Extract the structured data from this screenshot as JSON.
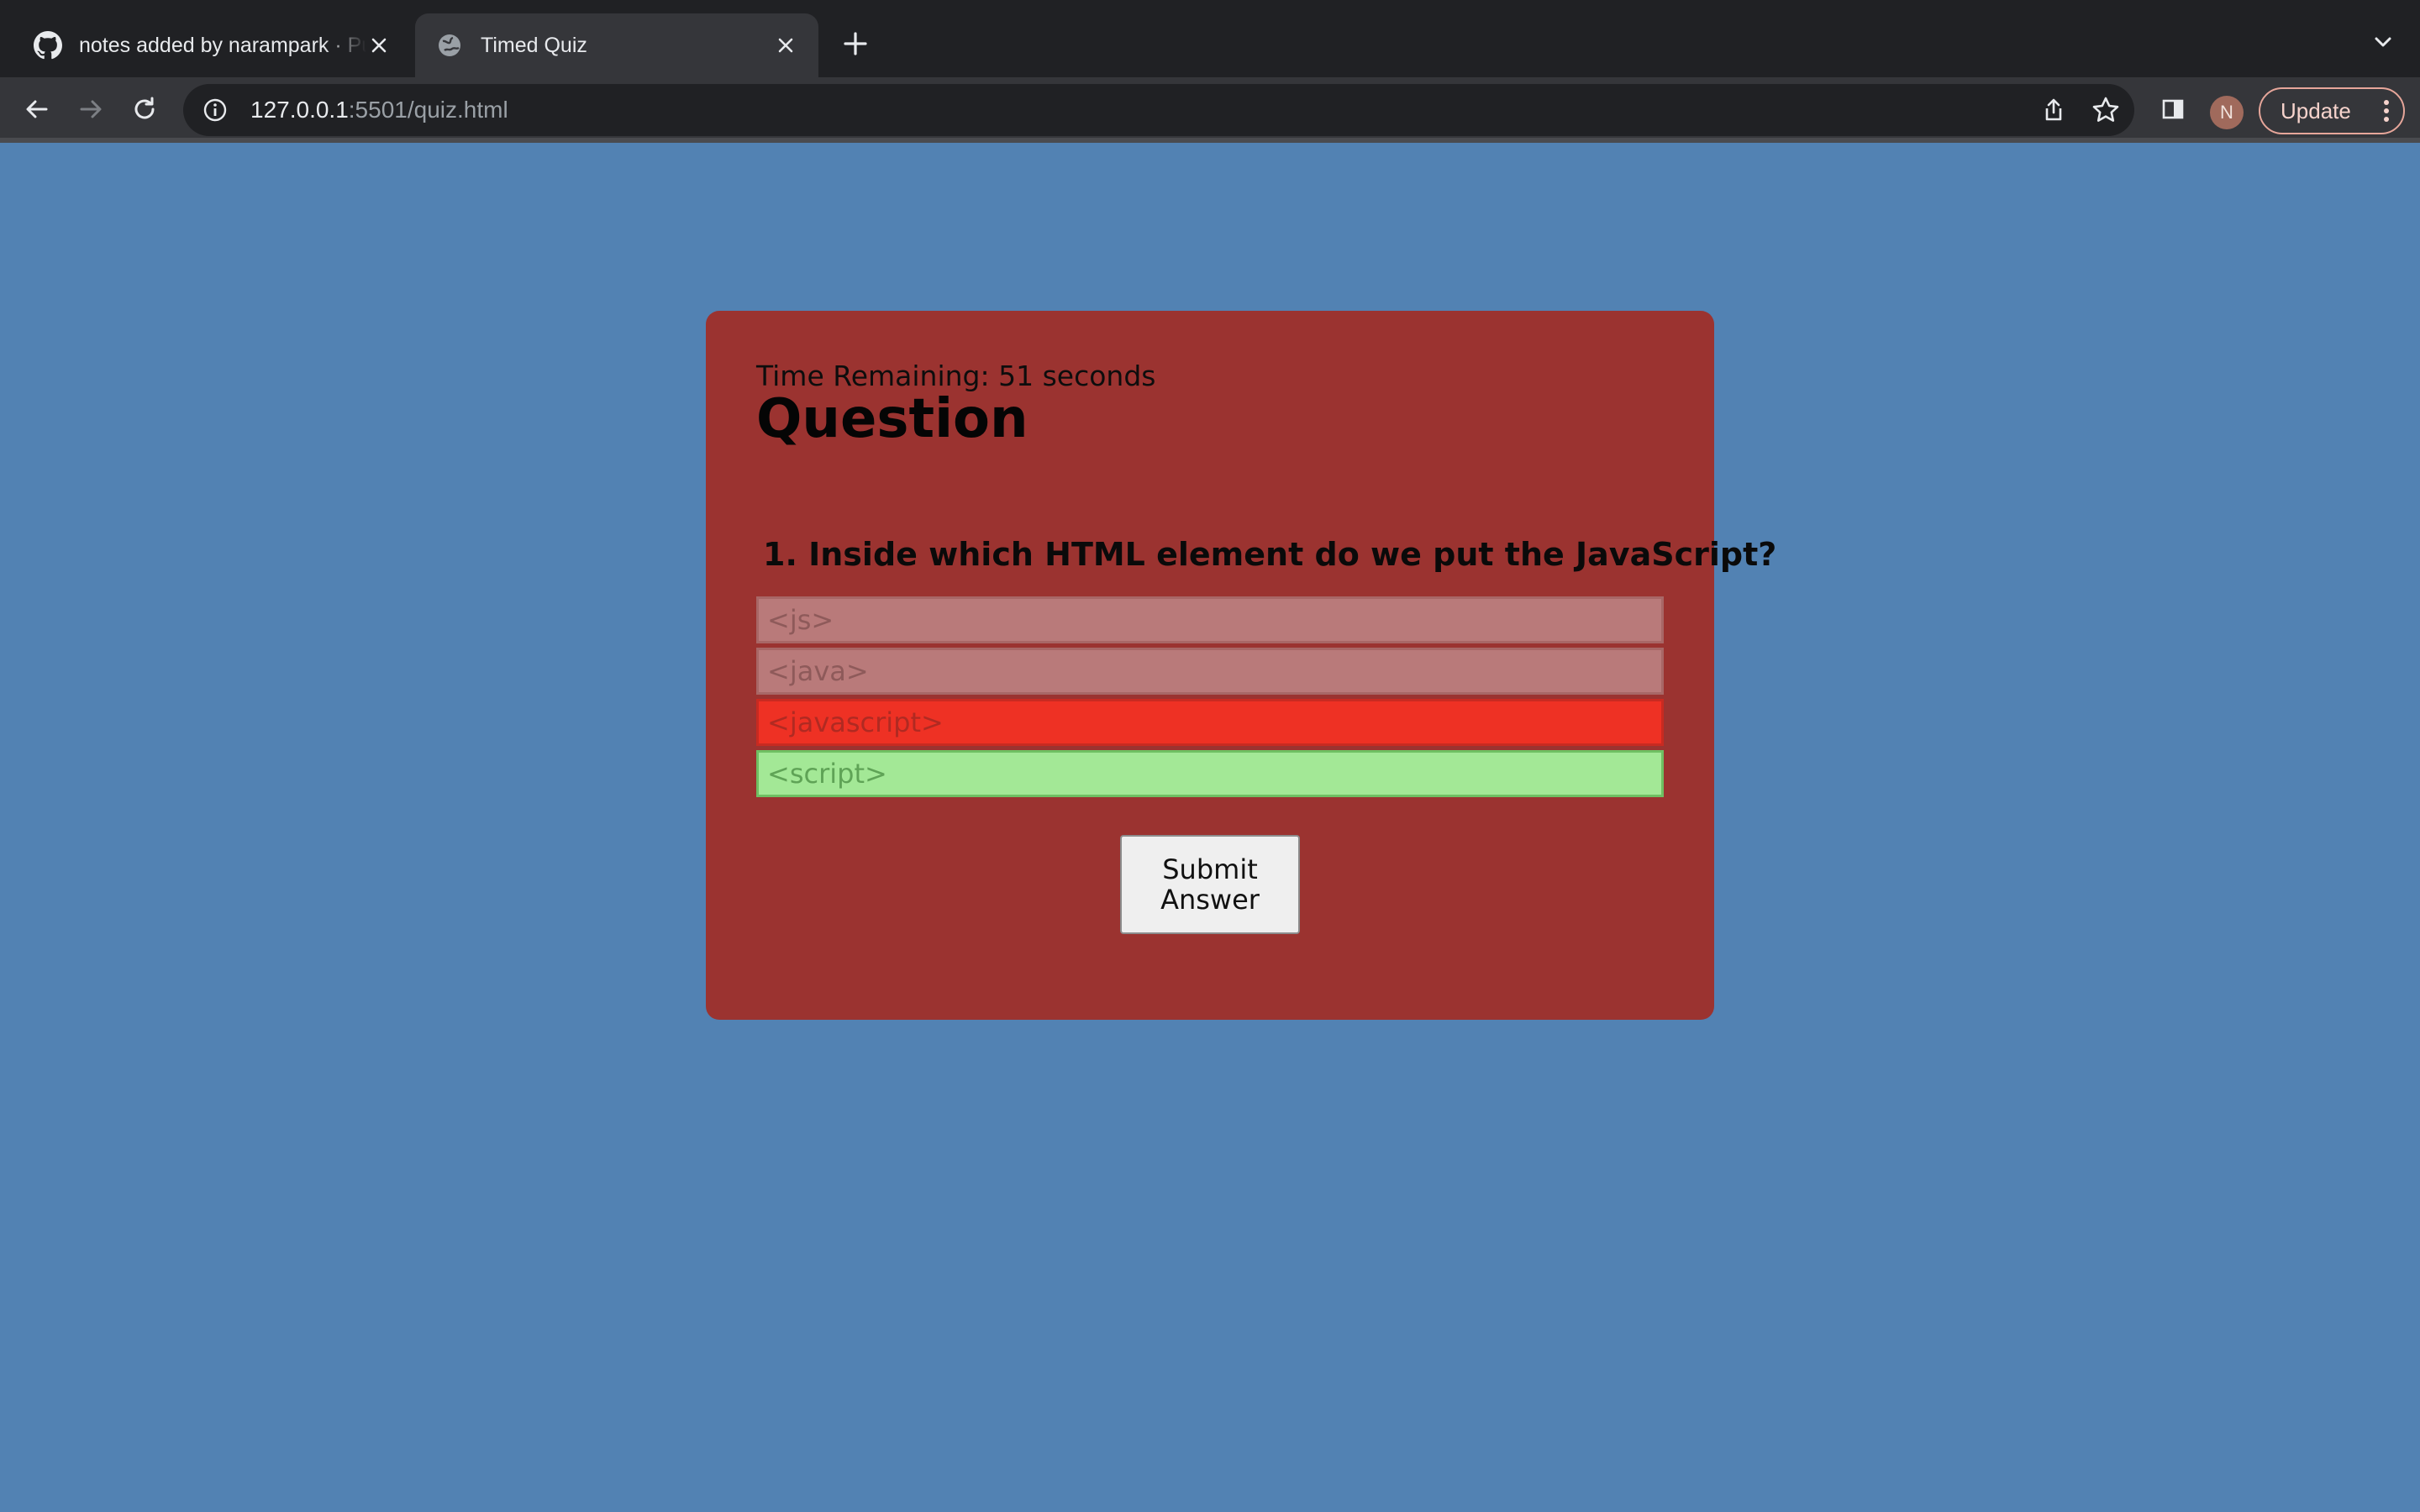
{
  "browser": {
    "tabs": [
      {
        "title": "notes added by narampark · Pull Request",
        "favicon": "github-icon",
        "active": false
      },
      {
        "title": "Timed Quiz",
        "favicon": "globe-icon",
        "active": true
      }
    ],
    "url": {
      "host": "127.0.0.1",
      "path": ":5501/quiz.html"
    },
    "avatar_letter": "N",
    "update_label": "Update"
  },
  "quiz": {
    "timer_text": "Time Remaining: 51 seconds",
    "heading": "Question",
    "question_text": "1. Inside which HTML element do we put the JavaScript?",
    "choices": [
      {
        "label": "<js>",
        "state": "neutral"
      },
      {
        "label": "<java>",
        "state": "neutral"
      },
      {
        "label": "<javascript>",
        "state": "incorrect"
      },
      {
        "label": "<script>",
        "state": "correct"
      }
    ],
    "submit_label": "Submit Answer"
  },
  "colors": {
    "page_background": "#5282b3",
    "card_background": "#9b3330",
    "choice_neutral": "#b97a7a",
    "choice_incorrect": "#ee3124",
    "choice_correct": "#a3e896"
  }
}
